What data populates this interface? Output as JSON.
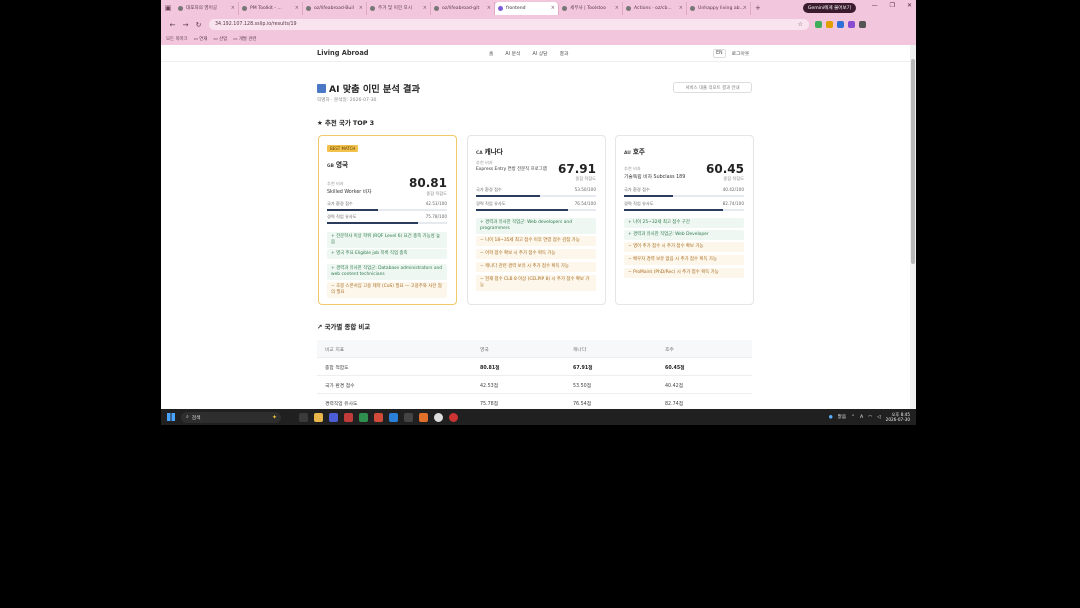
{
  "browser": {
    "tabs": [
      {
        "label": "대포자의 영어공"
      },
      {
        "label": "PM Toolkit - ..."
      },
      {
        "label": "oz/lifeabroad·Buil"
      },
      {
        "label": "주거 및 이민 모시"
      },
      {
        "label": "oz/lifeabroad·git"
      },
      {
        "label": "frontend"
      },
      {
        "label": "세무사 | Toolstoo"
      },
      {
        "label": "Actions · oz/cb..."
      },
      {
        "label": "Unhappy living ab..."
      }
    ],
    "new_tab": "+",
    "gemini_button": "Gemini에게 물어보기",
    "window_controls": [
      "—",
      "❐",
      "✕"
    ],
    "url": "34.192.107.128.sslip.io/results/19",
    "bookmarks": [
      "모든 북마크",
      "연재",
      "산업",
      "개발 관련"
    ]
  },
  "site": {
    "logo": "Living Abroad",
    "menu": [
      "홈",
      "AI 분석",
      "AI 상담",
      "결과"
    ],
    "lang": "EN",
    "logout": "로그아웃",
    "title": "AI 맞춤 이민 분석 결과",
    "subtitle": "익명자 · 분석일: 2026-07-30",
    "download_button": "서비스 대출 리포트 결과 안내",
    "top3_heading": "★ 추천 국가 TOP 3",
    "compare_heading": "↗ 국가별 종합 비교"
  },
  "cards": [
    {
      "best": true,
      "badge": "BEST MATCH",
      "code": "GB",
      "name": "영국",
      "score": "80.81",
      "score_label": "종합 적합도",
      "visa_label": "추천 비자",
      "visa": "Skilled Worker 비자",
      "metrics": [
        {
          "label": "국가 환경 점수",
          "value": "42.53/100",
          "fill": 0.4253
        },
        {
          "label": "경력 직업 유사도",
          "value": "75.78/100",
          "fill": 0.7578
        }
      ],
      "tips": [
        {
          "type": "pos",
          "text": "+ 전문학사 이상 학위 (RQF Level 6) 요건 충족 가능성 높음"
        },
        {
          "type": "pos",
          "text": "+ 영국 주요 Eligible job 목록 직업 충족"
        },
        {
          "type": "pos",
          "text": "+ 경력과 유사한 직업군: Database administrators and web content technicians"
        },
        {
          "type": "neg",
          "text": "− 초봉 스폰서십 고용 제약 (CoS) 필요 — 고용주와 사전 협의 필요"
        }
      ]
    },
    {
      "best": false,
      "code": "CA",
      "name": "캐나다",
      "score": "67.91",
      "score_label": "종합 적합도",
      "visa_label": "추천 비자",
      "visa": "Express Entry 연방 전문직 프로그램",
      "metrics": [
        {
          "label": "국가 환경 점수",
          "value": "53.50/100",
          "fill": 0.535
        },
        {
          "label": "경력 직업 유사도",
          "value": "76.54/100",
          "fill": 0.7654
        }
      ],
      "tips": [
        {
          "type": "pos",
          "text": "+ 경력과 유사한 직업군: Web developers and programmers"
        },
        {
          "type": "neg",
          "text": "− 나이 18~35세 최고 점수 이후 연령 점수 감점 가능"
        },
        {
          "type": "neg",
          "text": "− 어학 점수 확보 시 추가 점수 획득 가능"
        },
        {
          "type": "neg",
          "text": "− 캐나다 관련 경력 보유 시 추가 점수 획득 가능"
        },
        {
          "type": "neg",
          "text": "− 현재 점수 CLB 8 이상 (CELPIP 8) 시 추가 점수 확보 가능"
        }
      ]
    },
    {
      "best": false,
      "code": "AU",
      "name": "호주",
      "score": "60.45",
      "score_label": "종합 적합도",
      "visa_label": "추천 비자",
      "visa": "기술독립 비자 Subclass 189",
      "metrics": [
        {
          "label": "국가 환경 점수",
          "value": "40.42/100",
          "fill": 0.4042
        },
        {
          "label": "경력 직업 유사도",
          "value": "82.74/100",
          "fill": 0.8274
        }
      ],
      "tips": [
        {
          "type": "pos",
          "text": "+ 나이 25~32세 최고 점수 구간"
        },
        {
          "type": "pos",
          "text": "+ 경력과 유사한 직업군: Web Developer"
        },
        {
          "type": "neg",
          "text": "− 영어 추가 점수 시 추가 점수 확보 가능"
        },
        {
          "type": "neg",
          "text": "− 배우자 경력 보유 없음 시 추가 점수 획득 가능"
        },
        {
          "type": "neg",
          "text": "− ProMaint (PhD/Rec) 시 추가 점수 획득 가능"
        }
      ]
    }
  ],
  "comparison": {
    "headers": [
      "비교 지표",
      "영국",
      "캐나다",
      "호주"
    ],
    "rows": [
      [
        "종합 적합도",
        "80.81점",
        "67.91점",
        "60.45점"
      ],
      [
        "국가 환경 점수",
        "42.53점",
        "53.50점",
        "40.42점"
      ],
      [
        "경력직업 유사도",
        "75.78점",
        "76.54점",
        "82.74점"
      ]
    ]
  },
  "taskbar": {
    "search_placeholder": "검색",
    "weather": "맑음",
    "lang_indicator": "A",
    "time": "오후 8:45",
    "date": "2026-07-30"
  }
}
